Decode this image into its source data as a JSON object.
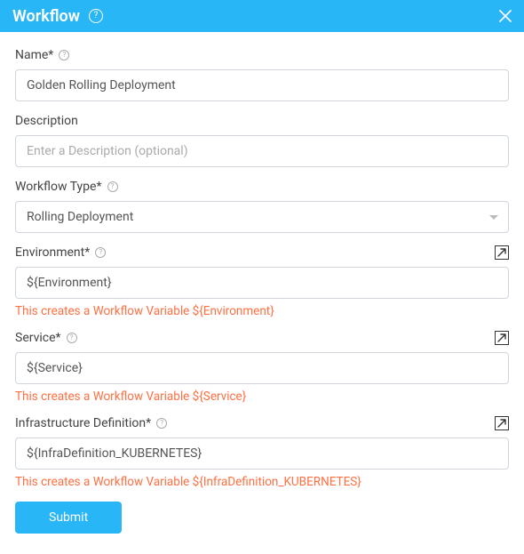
{
  "header": {
    "title": "Workflow"
  },
  "fields": {
    "name": {
      "label": "Name*",
      "value": "Golden Rolling Deployment"
    },
    "description": {
      "label": "Description",
      "placeholder": "Enter a Description (optional)",
      "value": ""
    },
    "workflowType": {
      "label": "Workflow Type*",
      "value": "Rolling Deployment"
    },
    "environment": {
      "label": "Environment*",
      "value": "${Environment}",
      "helper": "This creates a Workflow Variable ${Environment}"
    },
    "service": {
      "label": "Service*",
      "value": "${Service}",
      "helper": "This creates a Workflow Variable ${Service}"
    },
    "infra": {
      "label": "Infrastructure Definition*",
      "value": "${InfraDefinition_KUBERNETES}",
      "helper": "This creates a Workflow Variable ${InfraDefinition_KUBERNETES}"
    }
  },
  "actions": {
    "submit": "Submit"
  }
}
